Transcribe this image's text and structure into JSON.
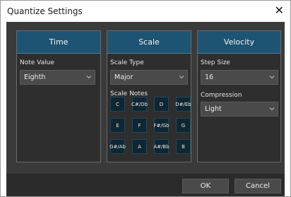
{
  "window": {
    "title": "Quantize Settings",
    "close_glyph": "✕"
  },
  "panels": {
    "time": {
      "title": "Time",
      "note_value_label": "Note Value",
      "note_value": "Eighth"
    },
    "scale": {
      "title": "Scale",
      "scale_type_label": "Scale Type",
      "scale_type": "Major",
      "scale_notes_label": "Scale Notes",
      "notes": [
        "C",
        "C#/Db",
        "D",
        "D#/Eb",
        "E",
        "F",
        "F#/Gb",
        "G",
        "G#/Ab",
        "A",
        "A#/Bb",
        "B"
      ]
    },
    "velocity": {
      "title": "Velocity",
      "step_size_label": "Step Size",
      "step_size": "16",
      "compression_label": "Compression",
      "compression": "Light"
    }
  },
  "footer": {
    "ok_label": "OK",
    "cancel_label": "Cancel"
  },
  "colors": {
    "panel_header": "#1e5473",
    "note_button": "#0f2733",
    "background": "#3a3a3a"
  },
  "icons": {
    "dropdown": "chevron-down-icon",
    "close": "close-icon"
  }
}
